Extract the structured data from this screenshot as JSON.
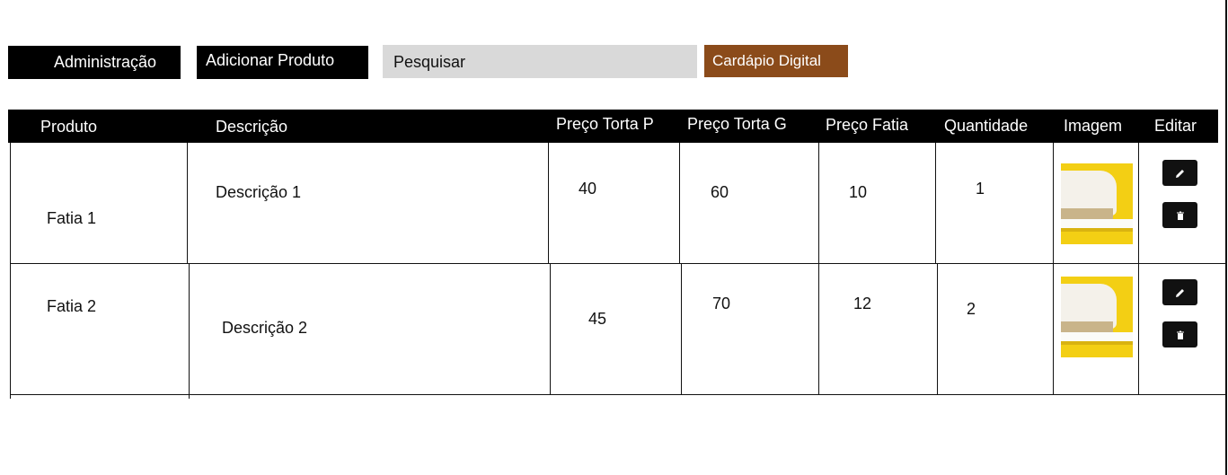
{
  "toolbar": {
    "admin_label": "Administração",
    "add_product_label": "Adicionar Produto",
    "search_placeholder": "Pesquisar",
    "brand_label": "Cardápio Digital"
  },
  "colors": {
    "brand": "#8b4b1a",
    "header_bg": "#000000",
    "search_bg": "#d9d9d9",
    "thumb_bg": "#f3cf14"
  },
  "table": {
    "headers": {
      "product": "Produto",
      "description": "Descrição",
      "price_small": "Preço Torta P",
      "price_large": "Preço Torta G",
      "price_slice": "Preço Fatia",
      "quantity": "Quantidade",
      "image": "Imagem",
      "edit": "Editar"
    },
    "rows": [
      {
        "product": "Fatia 1",
        "description": "Descrição 1",
        "price_small": "40",
        "price_large": "60",
        "price_slice": "10",
        "quantity": "1",
        "image_icon": "cake-slice-photo",
        "edit_icon": "pencil-icon",
        "delete_icon": "trash-icon"
      },
      {
        "product": "Fatia 2",
        "description": "Descrição 2",
        "price_small": "45",
        "price_large": "70",
        "price_slice": "12",
        "quantity": "2",
        "image_icon": "cake-slice-photo",
        "edit_icon": "pencil-icon",
        "delete_icon": "trash-icon"
      }
    ]
  }
}
